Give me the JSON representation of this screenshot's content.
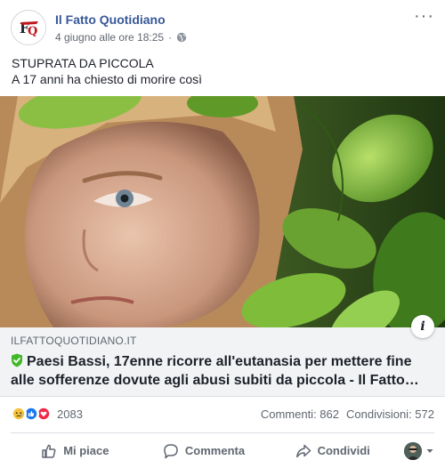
{
  "post": {
    "page_name": "Il Fatto Quotidiano",
    "timestamp": "4 giugno alle ore 18:25",
    "privacy": "globe-icon",
    "text_line1": "STUPRATA DA PICCOLA",
    "text_line2": "A 17 anni ha chiesto di morire così"
  },
  "link": {
    "domain": "ILFATTOQUOTIDIANO.IT",
    "headline": "Paesi Bassi, 17enne ricorre all'eutanasia per mettere fine alle sofferenze dovute agli abusi subiti da piccola - Il Fatto…",
    "info_label": "i"
  },
  "stats": {
    "reactions": [
      "sad",
      "like",
      "love"
    ],
    "reaction_count": "2083",
    "comments": "Commenti: 862",
    "shares": "Condivisioni: 572"
  },
  "actions": {
    "like": "Mi piace",
    "comment": "Commenta",
    "share": "Condividi"
  },
  "colors": {
    "link_blue": "#385898",
    "text": "#1d2129",
    "muted": "#606770",
    "link_bg": "#f2f3f5",
    "verified_green": "#42b72a"
  }
}
